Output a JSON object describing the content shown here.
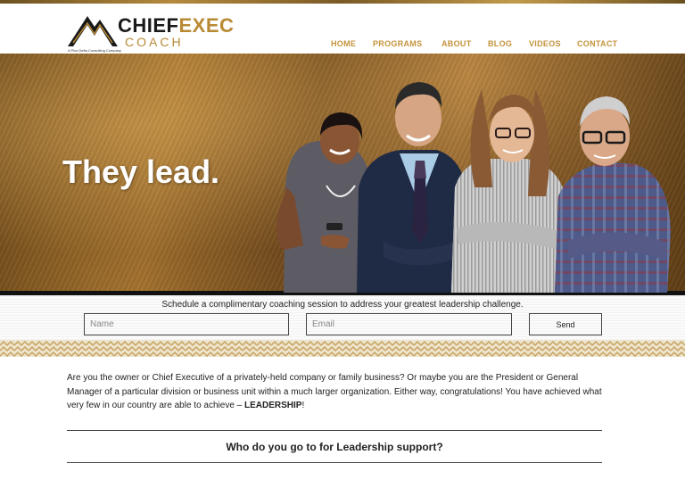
{
  "brand": {
    "chief": "CHIEF",
    "exec": "EXEC",
    "coach": "COACH",
    "tagline": "A Plus Delta Consulting Company"
  },
  "nav": {
    "items": [
      "HOME",
      "PROGRAMS",
      "ABOUT",
      "BLOG",
      "VIDEOS",
      "CONTACT"
    ]
  },
  "hero": {
    "title": "They lead."
  },
  "schedule": {
    "text": "Schedule a complimentary coaching session to address your greatest leadership challenge.",
    "name_placeholder": "Name",
    "email_placeholder": "Email",
    "send_label": "Send"
  },
  "content": {
    "intro_text": "Are you the owner or Chief Executive of a privately-held company or family business? Or maybe you are the President or General Manager of a particular division or business unit within a much larger organization. Either way, congratulations! You have achieved what very few in our country are able to achieve – ",
    "intro_emphasis": "LEADERSHIP",
    "intro_end": "!",
    "subhead": "Who do you go to for Leadership support?"
  },
  "colors": {
    "accent_gold": "#c4933c",
    "dark": "#1a1a1a"
  }
}
